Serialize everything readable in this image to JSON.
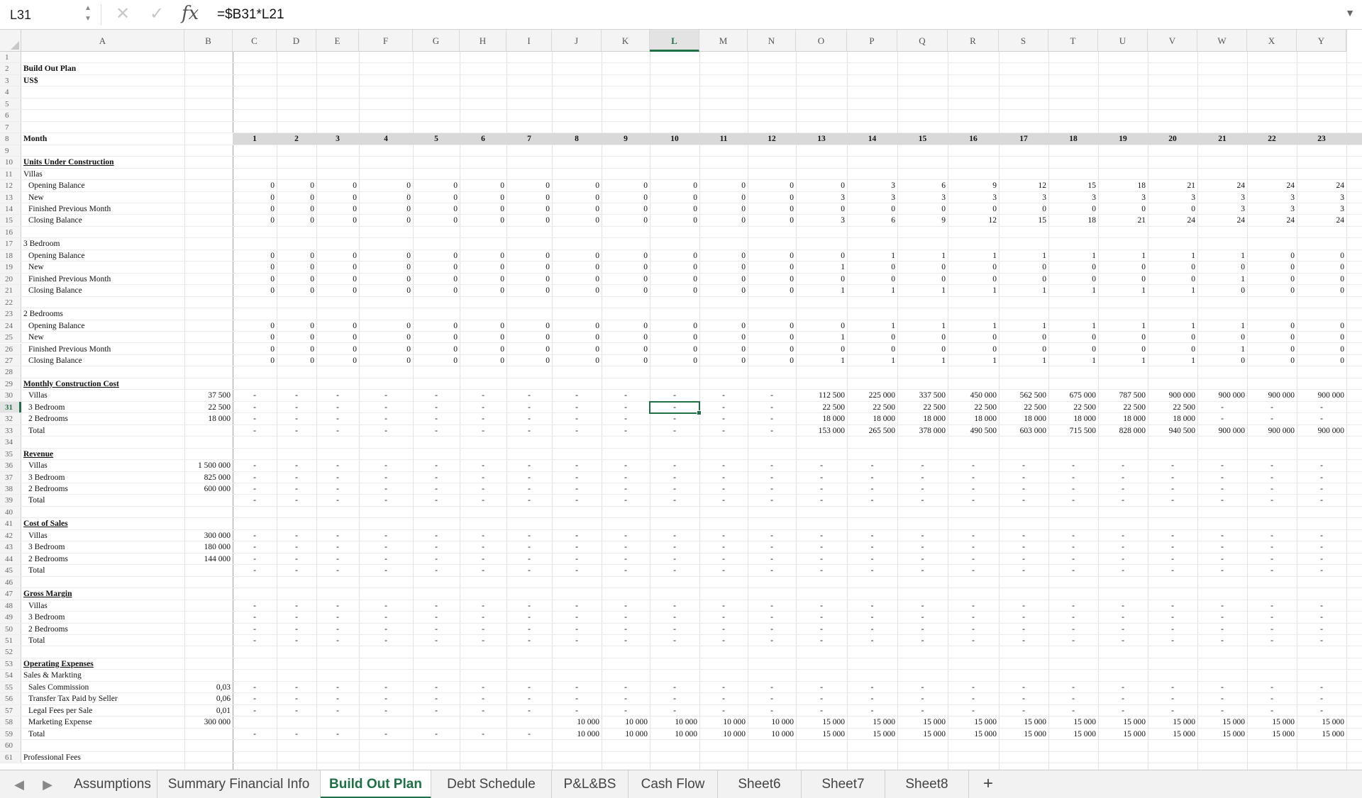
{
  "formula_bar": {
    "cell_ref": "L31",
    "formula": "=$B31*L21",
    "fx": "fx"
  },
  "columns": [
    "A",
    "B",
    "C",
    "D",
    "E",
    "F",
    "G",
    "H",
    "I",
    "J",
    "K",
    "L",
    "M",
    "N",
    "O",
    "P",
    "Q",
    "R",
    "S",
    "T",
    "U",
    "V",
    "W",
    "X",
    "Y"
  ],
  "selected_column": "L",
  "selected_row": 31,
  "rows": [
    {
      "n": 1
    },
    {
      "n": 2,
      "a": "Build Out Plan",
      "style": "b"
    },
    {
      "n": 3,
      "a": "US$",
      "style": "b"
    },
    {
      "n": 4
    },
    {
      "n": 5
    },
    {
      "n": 6
    },
    {
      "n": 7
    },
    {
      "n": 8,
      "a": "Month",
      "style": "b",
      "month": true,
      "v": [
        "1",
        "2",
        "3",
        "4",
        "5",
        "6",
        "7",
        "8",
        "9",
        "10",
        "11",
        "12",
        "13",
        "14",
        "15",
        "16",
        "17",
        "18",
        "19",
        "20",
        "21",
        "22",
        "23"
      ]
    },
    {
      "n": 9
    },
    {
      "n": 10,
      "a": "Units Under Construction",
      "style": "bu"
    },
    {
      "n": 11,
      "a": "Villas"
    },
    {
      "n": 12,
      "a": "Opening Balance",
      "ind": true,
      "v": [
        "0",
        "0",
        "0",
        "0",
        "0",
        "0",
        "0",
        "0",
        "0",
        "0",
        "0",
        "0",
        "0",
        "3",
        "6",
        "9",
        "12",
        "15",
        "18",
        "21",
        "24",
        "24",
        "24"
      ]
    },
    {
      "n": 13,
      "a": "New",
      "ind": true,
      "v": [
        "0",
        "0",
        "0",
        "0",
        "0",
        "0",
        "0",
        "0",
        "0",
        "0",
        "0",
        "0",
        "3",
        "3",
        "3",
        "3",
        "3",
        "3",
        "3",
        "3",
        "3",
        "3",
        "3"
      ]
    },
    {
      "n": 14,
      "a": "Finished Previous Month",
      "ind": true,
      "v": [
        "0",
        "0",
        "0",
        "0",
        "0",
        "0",
        "0",
        "0",
        "0",
        "0",
        "0",
        "0",
        "0",
        "0",
        "0",
        "0",
        "0",
        "0",
        "0",
        "0",
        "3",
        "3",
        "3"
      ]
    },
    {
      "n": 15,
      "a": "Closing Balance",
      "ind": true,
      "v": [
        "0",
        "0",
        "0",
        "0",
        "0",
        "0",
        "0",
        "0",
        "0",
        "0",
        "0",
        "0",
        "3",
        "6",
        "9",
        "12",
        "15",
        "18",
        "21",
        "24",
        "24",
        "24",
        "24"
      ]
    },
    {
      "n": 16
    },
    {
      "n": 17,
      "a": "3 Bedroom"
    },
    {
      "n": 18,
      "a": "Opening Balance",
      "ind": true,
      "v": [
        "0",
        "0",
        "0",
        "0",
        "0",
        "0",
        "0",
        "0",
        "0",
        "0",
        "0",
        "0",
        "0",
        "1",
        "1",
        "1",
        "1",
        "1",
        "1",
        "1",
        "1",
        "0",
        "0"
      ]
    },
    {
      "n": 19,
      "a": "New",
      "ind": true,
      "v": [
        "0",
        "0",
        "0",
        "0",
        "0",
        "0",
        "0",
        "0",
        "0",
        "0",
        "0",
        "0",
        "1",
        "0",
        "0",
        "0",
        "0",
        "0",
        "0",
        "0",
        "0",
        "0",
        "0"
      ]
    },
    {
      "n": 20,
      "a": "Finished Previous Month",
      "ind": true,
      "v": [
        "0",
        "0",
        "0",
        "0",
        "0",
        "0",
        "0",
        "0",
        "0",
        "0",
        "0",
        "0",
        "0",
        "0",
        "0",
        "0",
        "0",
        "0",
        "0",
        "0",
        "1",
        "0",
        "0"
      ]
    },
    {
      "n": 21,
      "a": "Closing Balance",
      "ind": true,
      "v": [
        "0",
        "0",
        "0",
        "0",
        "0",
        "0",
        "0",
        "0",
        "0",
        "0",
        "0",
        "0",
        "1",
        "1",
        "1",
        "1",
        "1",
        "1",
        "1",
        "1",
        "0",
        "0",
        "0"
      ]
    },
    {
      "n": 22
    },
    {
      "n": 23,
      "a": "2 Bedrooms"
    },
    {
      "n": 24,
      "a": "Opening Balance",
      "ind": true,
      "v": [
        "0",
        "0",
        "0",
        "0",
        "0",
        "0",
        "0",
        "0",
        "0",
        "0",
        "0",
        "0",
        "0",
        "1",
        "1",
        "1",
        "1",
        "1",
        "1",
        "1",
        "1",
        "0",
        "0"
      ]
    },
    {
      "n": 25,
      "a": "New",
      "ind": true,
      "v": [
        "0",
        "0",
        "0",
        "0",
        "0",
        "0",
        "0",
        "0",
        "0",
        "0",
        "0",
        "0",
        "1",
        "0",
        "0",
        "0",
        "0",
        "0",
        "0",
        "0",
        "0",
        "0",
        "0"
      ]
    },
    {
      "n": 26,
      "a": "Finished Previous Month",
      "ind": true,
      "v": [
        "0",
        "0",
        "0",
        "0",
        "0",
        "0",
        "0",
        "0",
        "0",
        "0",
        "0",
        "0",
        "0",
        "0",
        "0",
        "0",
        "0",
        "0",
        "0",
        "0",
        "1",
        "0",
        "0"
      ]
    },
    {
      "n": 27,
      "a": "Closing Balance",
      "ind": true,
      "v": [
        "0",
        "0",
        "0",
        "0",
        "0",
        "0",
        "0",
        "0",
        "0",
        "0",
        "0",
        "0",
        "1",
        "1",
        "1",
        "1",
        "1",
        "1",
        "1",
        "1",
        "0",
        "0",
        "0"
      ]
    },
    {
      "n": 28
    },
    {
      "n": 29,
      "a": "Monthly Construction Cost",
      "style": "bu"
    },
    {
      "n": 30,
      "a": "Villas",
      "ind": true,
      "b": "37 500",
      "v": [
        "-",
        "-",
        "-",
        "-",
        "-",
        "-",
        "-",
        "-",
        "-",
        "-",
        "-",
        "-",
        "112 500",
        "225 000",
        "337 500",
        "450 000",
        "562 500",
        "675 000",
        "787 500",
        "900 000",
        "900 000",
        "900 000",
        "900 000"
      ]
    },
    {
      "n": 31,
      "a": "3 Bedroom",
      "ind": true,
      "b": "22 500",
      "v": [
        "-",
        "-",
        "-",
        "-",
        "-",
        "-",
        "-",
        "-",
        "-",
        "-",
        "-",
        "-",
        "22 500",
        "22 500",
        "22 500",
        "22 500",
        "22 500",
        "22 500",
        "22 500",
        "22 500",
        "-",
        "-",
        "-"
      ]
    },
    {
      "n": 32,
      "a": "2 Bedrooms",
      "ind": true,
      "b": "18 000",
      "v": [
        "-",
        "-",
        "-",
        "-",
        "-",
        "-",
        "-",
        "-",
        "-",
        "-",
        "-",
        "-",
        "18 000",
        "18 000",
        "18 000",
        "18 000",
        "18 000",
        "18 000",
        "18 000",
        "18 000",
        "-",
        "-",
        "-"
      ]
    },
    {
      "n": 33,
      "a": "Total",
      "ind": true,
      "v": [
        "-",
        "-",
        "-",
        "-",
        "-",
        "-",
        "-",
        "-",
        "-",
        "-",
        "-",
        "-",
        "153 000",
        "265 500",
        "378 000",
        "490 500",
        "603 000",
        "715 500",
        "828 000",
        "940 500",
        "900 000",
        "900 000",
        "900 000"
      ]
    },
    {
      "n": 34
    },
    {
      "n": 35,
      "a": "Revenue",
      "style": "bu"
    },
    {
      "n": 36,
      "a": "Villas",
      "ind": true,
      "b": "1 500 000",
      "v": [
        "-",
        "-",
        "-",
        "-",
        "-",
        "-",
        "-",
        "-",
        "-",
        "-",
        "-",
        "-",
        "-",
        "-",
        "-",
        "-",
        "-",
        "-",
        "-",
        "-",
        "-",
        "-",
        "-"
      ]
    },
    {
      "n": 37,
      "a": "3 Bedroom",
      "ind": true,
      "b": "825 000",
      "v": [
        "-",
        "-",
        "-",
        "-",
        "-",
        "-",
        "-",
        "-",
        "-",
        "-",
        "-",
        "-",
        "-",
        "-",
        "-",
        "-",
        "-",
        "-",
        "-",
        "-",
        "-",
        "-",
        "-"
      ]
    },
    {
      "n": 38,
      "a": "2 Bedrooms",
      "ind": true,
      "b": "600 000",
      "v": [
        "-",
        "-",
        "-",
        "-",
        "-",
        "-",
        "-",
        "-",
        "-",
        "-",
        "-",
        "-",
        "-",
        "-",
        "-",
        "-",
        "-",
        "-",
        "-",
        "-",
        "-",
        "-",
        "-"
      ]
    },
    {
      "n": 39,
      "a": "Total",
      "ind": true,
      "v": [
        "-",
        "-",
        "-",
        "-",
        "-",
        "-",
        "-",
        "-",
        "-",
        "-",
        "-",
        "-",
        "-",
        "-",
        "-",
        "-",
        "-",
        "-",
        "-",
        "-",
        "-",
        "-",
        "-"
      ]
    },
    {
      "n": 40
    },
    {
      "n": 41,
      "a": "Cost of Sales",
      "style": "bu"
    },
    {
      "n": 42,
      "a": "Villas",
      "ind": true,
      "b": "300 000",
      "v": [
        "-",
        "-",
        "-",
        "-",
        "-",
        "-",
        "-",
        "-",
        "-",
        "-",
        "-",
        "-",
        "-",
        "-",
        "-",
        "-",
        "-",
        "-",
        "-",
        "-",
        "-",
        "-",
        "-"
      ]
    },
    {
      "n": 43,
      "a": "3 Bedroom",
      "ind": true,
      "b": "180 000",
      "v": [
        "-",
        "-",
        "-",
        "-",
        "-",
        "-",
        "-",
        "-",
        "-",
        "-",
        "-",
        "-",
        "-",
        "-",
        "-",
        "-",
        "-",
        "-",
        "-",
        "-",
        "-",
        "-",
        "-"
      ]
    },
    {
      "n": 44,
      "a": "2 Bedrooms",
      "ind": true,
      "b": "144 000",
      "v": [
        "-",
        "-",
        "-",
        "-",
        "-",
        "-",
        "-",
        "-",
        "-",
        "-",
        "-",
        "-",
        "-",
        "-",
        "-",
        "-",
        "-",
        "-",
        "-",
        "-",
        "-",
        "-",
        "-"
      ]
    },
    {
      "n": 45,
      "a": "Total",
      "ind": true,
      "v": [
        "-",
        "-",
        "-",
        "-",
        "-",
        "-",
        "-",
        "-",
        "-",
        "-",
        "-",
        "-",
        "-",
        "-",
        "-",
        "-",
        "-",
        "-",
        "-",
        "-",
        "-",
        "-",
        "-"
      ]
    },
    {
      "n": 46
    },
    {
      "n": 47,
      "a": "Gross Margin",
      "style": "bu"
    },
    {
      "n": 48,
      "a": "Villas",
      "ind": true,
      "v": [
        "-",
        "-",
        "-",
        "-",
        "-",
        "-",
        "-",
        "-",
        "-",
        "-",
        "-",
        "-",
        "-",
        "-",
        "-",
        "-",
        "-",
        "-",
        "-",
        "-",
        "-",
        "-",
        "-"
      ]
    },
    {
      "n": 49,
      "a": "3 Bedroom",
      "ind": true,
      "v": [
        "-",
        "-",
        "-",
        "-",
        "-",
        "-",
        "-",
        "-",
        "-",
        "-",
        "-",
        "-",
        "-",
        "-",
        "-",
        "-",
        "-",
        "-",
        "-",
        "-",
        "-",
        "-",
        "-"
      ]
    },
    {
      "n": 50,
      "a": "2 Bedrooms",
      "ind": true,
      "v": [
        "-",
        "-",
        "-",
        "-",
        "-",
        "-",
        "-",
        "-",
        "-",
        "-",
        "-",
        "-",
        "-",
        "-",
        "-",
        "-",
        "-",
        "-",
        "-",
        "-",
        "-",
        "-",
        "-"
      ]
    },
    {
      "n": 51,
      "a": "Total",
      "ind": true,
      "v": [
        "-",
        "-",
        "-",
        "-",
        "-",
        "-",
        "-",
        "-",
        "-",
        "-",
        "-",
        "-",
        "-",
        "-",
        "-",
        "-",
        "-",
        "-",
        "-",
        "-",
        "-",
        "-",
        "-"
      ]
    },
    {
      "n": 52
    },
    {
      "n": 53,
      "a": "Operating Expenses",
      "style": "bu"
    },
    {
      "n": 54,
      "a": "Sales & Markting"
    },
    {
      "n": 55,
      "a": "Sales Commission",
      "ind": true,
      "b": "0,03",
      "v": [
        "-",
        "-",
        "-",
        "-",
        "-",
        "-",
        "-",
        "-",
        "-",
        "-",
        "-",
        "-",
        "-",
        "-",
        "-",
        "-",
        "-",
        "-",
        "-",
        "-",
        "-",
        "-",
        "-"
      ]
    },
    {
      "n": 56,
      "a": "Transfer Tax Paid by Seller",
      "ind": true,
      "b": "0,06",
      "v": [
        "-",
        "-",
        "-",
        "-",
        "-",
        "-",
        "-",
        "-",
        "-",
        "-",
        "-",
        "-",
        "-",
        "-",
        "-",
        "-",
        "-",
        "-",
        "-",
        "-",
        "-",
        "-",
        "-"
      ]
    },
    {
      "n": 57,
      "a": "Legal Fees per Sale",
      "ind": true,
      "b": "0,01",
      "v": [
        "-",
        "-",
        "-",
        "-",
        "-",
        "-",
        "-",
        "-",
        "-",
        "-",
        "-",
        "-",
        "-",
        "-",
        "-",
        "-",
        "-",
        "-",
        "-",
        "-",
        "-",
        "-",
        "-"
      ]
    },
    {
      "n": 58,
      "a": "Marketing Expense",
      "ind": true,
      "b": "300 000",
      "v": [
        "",
        "",
        "",
        "",
        "",
        "",
        "",
        "10 000",
        "10 000",
        "10 000",
        "10 000",
        "10 000",
        "15 000",
        "15 000",
        "15 000",
        "15 000",
        "15 000",
        "15 000",
        "15 000",
        "15 000",
        "15 000",
        "15 000",
        "15 000"
      ]
    },
    {
      "n": 59,
      "a": "Total",
      "ind": true,
      "v": [
        "-",
        "-",
        "-",
        "-",
        "-",
        "-",
        "-",
        "10 000",
        "10 000",
        "10 000",
        "10 000",
        "10 000",
        "15 000",
        "15 000",
        "15 000",
        "15 000",
        "15 000",
        "15 000",
        "15 000",
        "15 000",
        "15 000",
        "15 000",
        "15 000"
      ]
    },
    {
      "n": 60
    },
    {
      "n": 61,
      "a": "Professional Fees"
    }
  ],
  "sheet_tabs": [
    "Assumptions",
    "Summary Financial Info",
    "Build Out Plan",
    "Debt Schedule",
    "P&L&BS",
    "Cash Flow",
    "Sheet6",
    "Sheet7",
    "Sheet8"
  ],
  "active_tab": "Build Out Plan",
  "icons": {
    "stepper": "stepper-icon",
    "cancel": "cancel-icon",
    "enter": "enter-icon",
    "fx": "function-icon",
    "prev_sheet": "chevron-left-icon",
    "next_sheet": "chevron-right-icon",
    "add_sheet": "plus-icon"
  },
  "colors": {
    "accent": "#1e7145",
    "month_band": "#d9d9d9"
  }
}
